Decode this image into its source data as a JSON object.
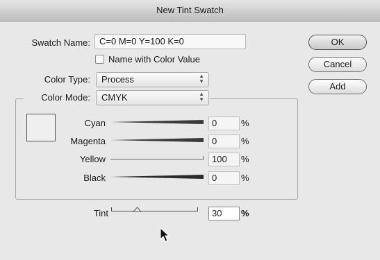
{
  "window": {
    "title": "New Tint Swatch"
  },
  "swatch_name": {
    "label": "Swatch Name:",
    "value": "C=0 M=0 Y=100 K=0"
  },
  "name_with_color_value": {
    "label": "Name with Color Value",
    "checked": false
  },
  "color_type": {
    "label": "Color Type:",
    "selected": "Process"
  },
  "color_mode": {
    "label": "Color Mode:",
    "selected": "CMYK"
  },
  "channels": [
    {
      "name": "Cyan",
      "value": "0",
      "unit": "%"
    },
    {
      "name": "Magenta",
      "value": "0",
      "unit": "%"
    },
    {
      "name": "Yellow",
      "value": "100",
      "unit": "%"
    },
    {
      "name": "Black",
      "value": "0",
      "unit": "%"
    }
  ],
  "tint": {
    "label": "Tint",
    "value": "30",
    "unit": "%",
    "level_percent": 30
  },
  "buttons": {
    "ok": "OK",
    "cancel": "Cancel",
    "add": "Add"
  },
  "colors": {
    "window_bg": "#e8e8e8",
    "slider_dark": "#2f2f2f"
  }
}
